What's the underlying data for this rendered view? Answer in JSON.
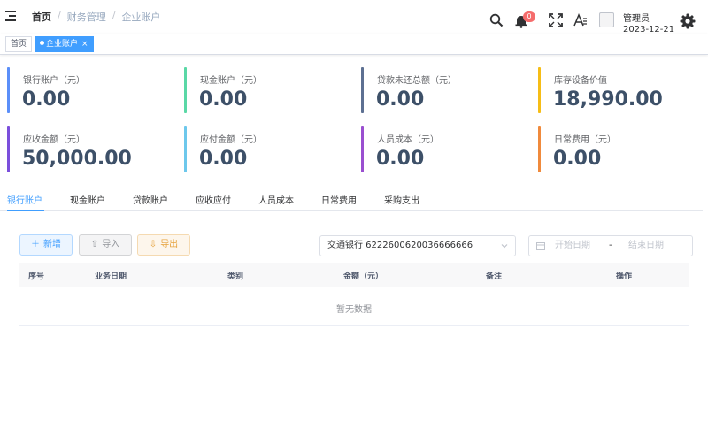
{
  "header": {
    "breadcrumb": [
      "首页",
      "财务管理",
      "企业账户"
    ],
    "notification_count": "0",
    "user": {
      "name": "管理员",
      "date": "2023-12-21"
    }
  },
  "tags": [
    {
      "label": "首页",
      "active": false
    },
    {
      "label": "企业账户",
      "active": true,
      "close": "×"
    }
  ],
  "cards": [
    {
      "label": "银行账户（元）",
      "value": "0.00",
      "color": "#5b8ff9"
    },
    {
      "label": "现金账户（元）",
      "value": "0.00",
      "color": "#5ad8a6"
    },
    {
      "label": "贷款未还总额（元）",
      "value": "0.00",
      "color": "#5d7092"
    },
    {
      "label": "库存设备价值",
      "value": "18,990.00",
      "color": "#f6bd16"
    },
    {
      "label": "应收金额（元）",
      "value": "50,000.00",
      "color": "#7b4fdc"
    },
    {
      "label": "应付金额（元）",
      "value": "0.00",
      "color": "#6dc8ec"
    },
    {
      "label": "人员成本（元）",
      "value": "0.00",
      "color": "#9a4fd0"
    },
    {
      "label": "日常费用（元）",
      "value": "0.00",
      "color": "#f08a3c"
    }
  ],
  "tabs": [
    "银行账户",
    "现金账户",
    "贷款账户",
    "应收应付",
    "人员成本",
    "日常费用",
    "采购支出"
  ],
  "toolbar": {
    "add_label": "新增",
    "import_label": "导入",
    "export_label": "导出",
    "account_select": "交通银行  6222600620036666666",
    "date_start_placeholder": "开始日期",
    "date_separator": "-",
    "date_end_placeholder": "结束日期"
  },
  "table": {
    "columns": [
      "序号",
      "业务日期",
      "类别",
      "金额（元）",
      "备注",
      "操作"
    ],
    "empty_text": "暂无数据"
  },
  "colors": {
    "accent": "#409eff",
    "badge": "#f56c6c"
  }
}
